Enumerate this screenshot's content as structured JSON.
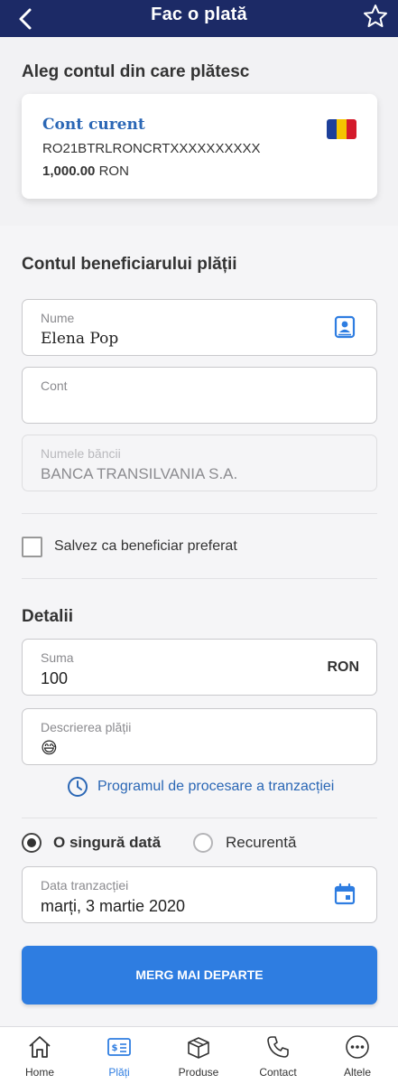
{
  "header": {
    "title": "Fac o plată"
  },
  "source": {
    "title": "Aleg contul din care plătesc",
    "account": {
      "name": "Cont curent",
      "iban": "RO21BTRLRONCRTXXXXXXXXXX",
      "balance": "1,000.00",
      "currency": "RON"
    }
  },
  "beneficiary": {
    "title": "Contul beneficiarului plății",
    "name": {
      "label": "Nume",
      "value": "Elena Pop"
    },
    "account": {
      "label": "Cont",
      "value": ""
    },
    "bank": {
      "label": "Numele băncii",
      "value": "BANCA TRANSILVANIA S.A."
    },
    "save_favorite": {
      "label": "Salvez ca beneficiar preferat",
      "checked": false
    }
  },
  "details": {
    "title": "Detalii",
    "amount": {
      "label": "Suma",
      "value": "100",
      "currency": "RON"
    },
    "description": {
      "label": "Descrierea plății",
      "value": "😅"
    },
    "schedule_link": "Programul de procesare a tranzacției",
    "frequency": {
      "options": [
        "O singură dată",
        "Recurentă"
      ],
      "selected": "O singură dată"
    },
    "date": {
      "label": "Data tranzacției",
      "value": "marți, 3 martie 2020"
    }
  },
  "continue_label": "MERG MAI DEPARTE",
  "tabs": [
    {
      "label": "Home",
      "icon": "home-icon"
    },
    {
      "label": "Plăți",
      "icon": "payments-icon",
      "active": true
    },
    {
      "label": "Produse",
      "icon": "box-icon"
    },
    {
      "label": "Contact",
      "icon": "phone-icon"
    },
    {
      "label": "Altele",
      "icon": "more-icon"
    }
  ],
  "colors": {
    "header": "#1c2a66",
    "accent": "#2e7de1",
    "link": "#2b67b5"
  }
}
